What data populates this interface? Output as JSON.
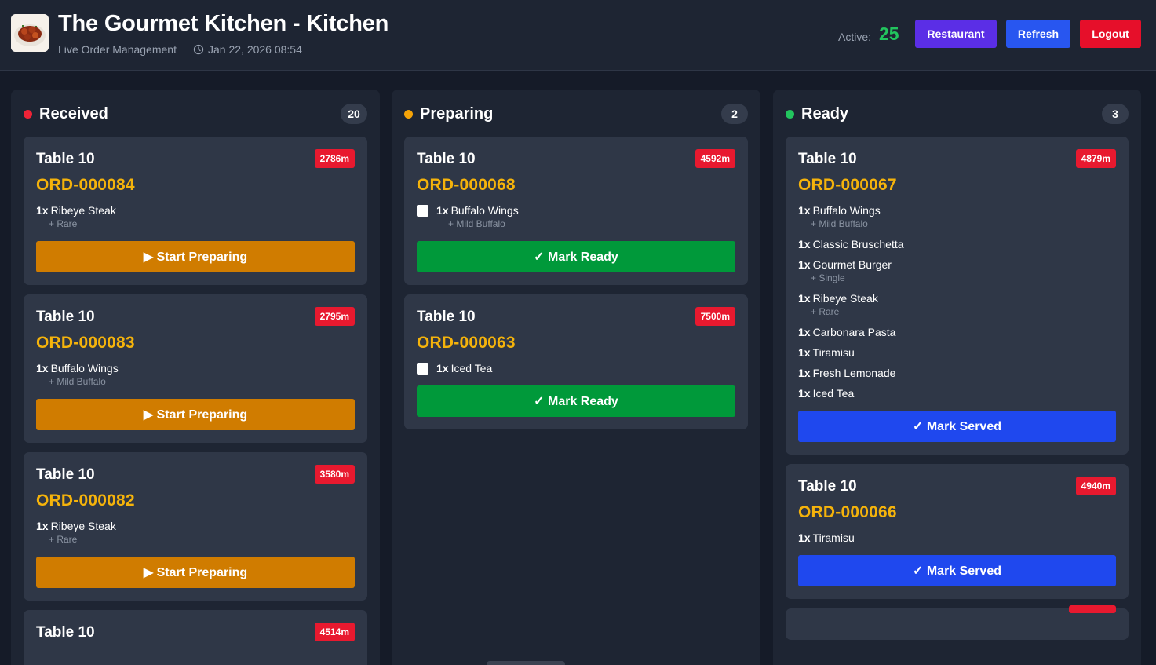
{
  "header": {
    "title": "The Gourmet Kitchen - Kitchen",
    "subtitle": "Live Order Management",
    "datetime": "Jan 22, 2026 08:54",
    "active_label": "Active:",
    "active_count": "25",
    "buttons": {
      "restaurant": "Restaurant",
      "refresh": "Refresh",
      "logout": "Logout"
    }
  },
  "colors": {
    "received": "#ef2337",
    "preparing": "#f5a308",
    "ready": "#22c55e",
    "order_id": "#f5b30b",
    "time_badge": "#e8192f"
  },
  "columns": {
    "received": {
      "title": "Received",
      "count": "20",
      "cards": [
        {
          "table": "Table 10",
          "time": "2786m",
          "order": "ORD-000084",
          "items": [
            {
              "qty": "1x",
              "name": "Ribeye Steak",
              "mod": "+ Rare"
            }
          ],
          "action": "▶ Start Preparing"
        },
        {
          "table": "Table 10",
          "time": "2795m",
          "order": "ORD-000083",
          "items": [
            {
              "qty": "1x",
              "name": "Buffalo Wings",
              "mod": "+ Mild Buffalo"
            }
          ],
          "action": "▶ Start Preparing"
        },
        {
          "table": "Table 10",
          "time": "3580m",
          "order": "ORD-000082",
          "items": [
            {
              "qty": "1x",
              "name": "Ribeye Steak",
              "mod": "+ Rare"
            }
          ],
          "action": "▶ Start Preparing"
        },
        {
          "table": "Table 10",
          "time": "4514m"
        }
      ]
    },
    "preparing": {
      "title": "Preparing",
      "count": "2",
      "cards": [
        {
          "table": "Table 10",
          "time": "4592m",
          "order": "ORD-000068",
          "items": [
            {
              "qty": "1x",
              "name": "Buffalo Wings",
              "mod": "+ Mild Buffalo"
            }
          ],
          "action": "✓ Mark Ready"
        },
        {
          "table": "Table 10",
          "time": "7500m",
          "order": "ORD-000063",
          "items": [
            {
              "qty": "1x",
              "name": "Iced Tea"
            }
          ],
          "action": "✓ Mark Ready"
        }
      ]
    },
    "ready": {
      "title": "Ready",
      "count": "3",
      "cards": [
        {
          "table": "Table 10",
          "time": "4879m",
          "order": "ORD-000067",
          "items": [
            {
              "qty": "1x",
              "name": "Buffalo Wings",
              "mod": "+ Mild Buffalo"
            },
            {
              "qty": "1x",
              "name": "Classic Bruschetta"
            },
            {
              "qty": "1x",
              "name": "Gourmet Burger",
              "mod": "+ Single"
            },
            {
              "qty": "1x",
              "name": "Ribeye Steak",
              "mod": "+ Rare"
            },
            {
              "qty": "1x",
              "name": "Carbonara Pasta"
            },
            {
              "qty": "1x",
              "name": "Tiramisu"
            },
            {
              "qty": "1x",
              "name": "Fresh Lemonade"
            },
            {
              "qty": "1x",
              "name": "Iced Tea"
            }
          ],
          "action": "✓ Mark Served"
        },
        {
          "table": "Table 10",
          "time": "4940m",
          "order": "ORD-000066",
          "items": [
            {
              "qty": "1x",
              "name": "Tiramisu"
            }
          ],
          "action": "✓ Mark Served"
        }
      ]
    }
  }
}
